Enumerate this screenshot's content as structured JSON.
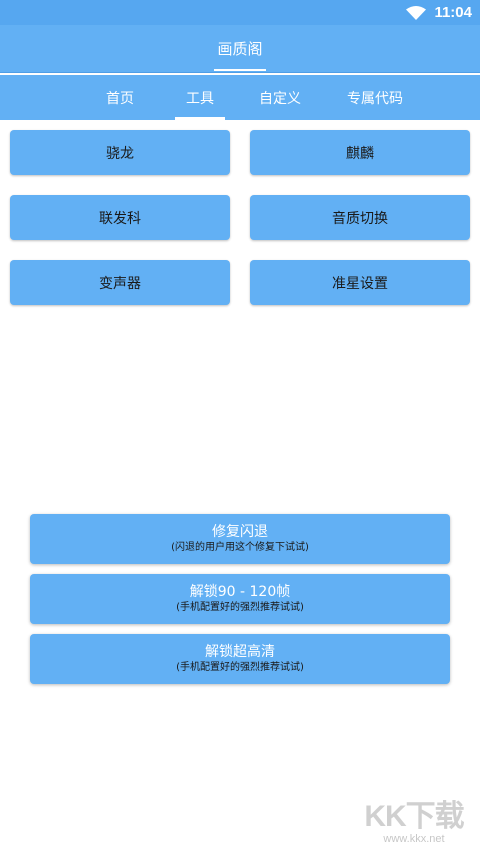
{
  "status_bar": {
    "time": "11:04",
    "wifi_icon": "wifi-icon"
  },
  "app": {
    "title": "画质阁",
    "colors": {
      "primary": "#62b0f4",
      "status": "#56a7f0",
      "text_dark": "#1a1a1a",
      "text_light": "#ffffff"
    }
  },
  "tabs": [
    {
      "label": "首页",
      "selected": false
    },
    {
      "label": "工具",
      "selected": true
    },
    {
      "label": "自定义",
      "selected": false
    },
    {
      "label": "专属代码",
      "selected": false
    }
  ],
  "tool_buttons": [
    {
      "label": "骁龙"
    },
    {
      "label": "麒麟"
    },
    {
      "label": "联发科"
    },
    {
      "label": "音质切换"
    },
    {
      "label": "变声器"
    },
    {
      "label": "准星设置"
    }
  ],
  "actions": [
    {
      "title": "修复闪退",
      "subtitle": "(闪退的用户用这个修复下试试)"
    },
    {
      "title": "解锁90 - 120帧",
      "subtitle": "(手机配置好的强烈推荐试试)"
    },
    {
      "title": "解锁超高清",
      "subtitle": "(手机配置好的强烈推荐试试)"
    }
  ],
  "watermark": {
    "logo": "KK下载",
    "url": "www.kkx.net"
  }
}
